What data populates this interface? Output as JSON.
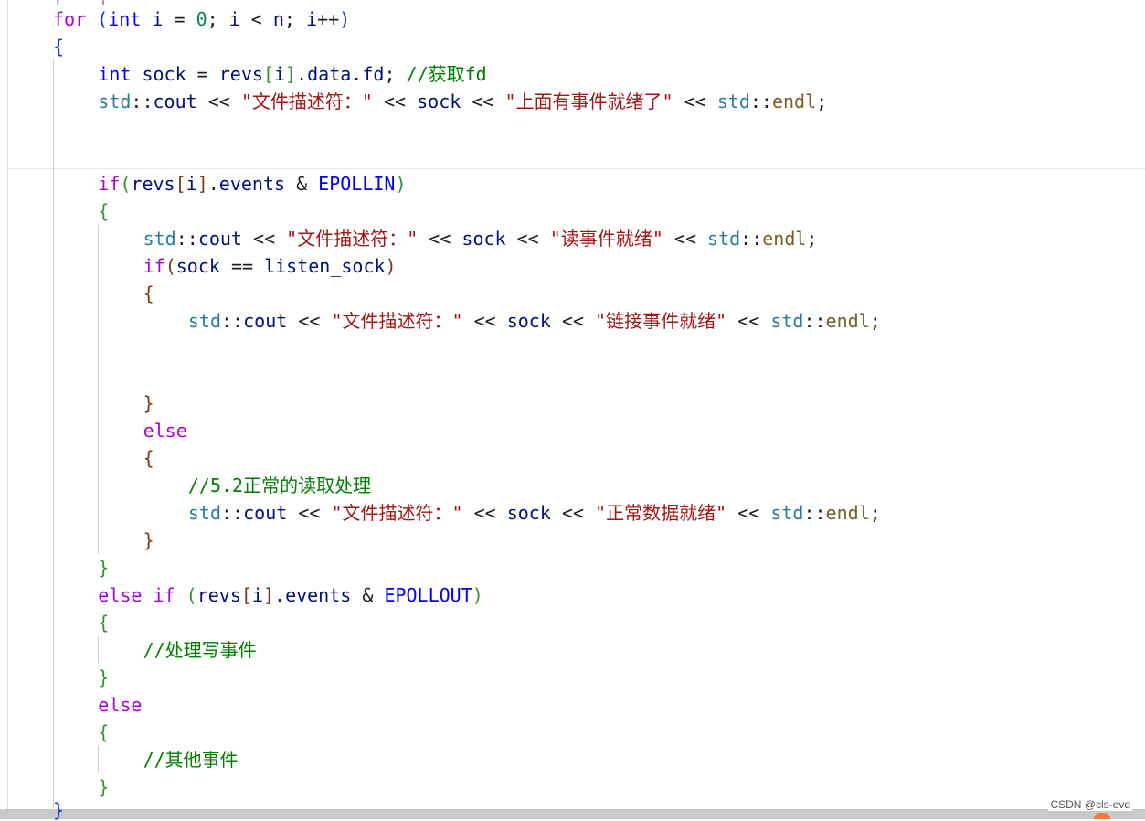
{
  "editor": {
    "top_partial": "( , )",
    "code_lines": [
      {
        "indent": 1,
        "tokens": [
          [
            "kw",
            "for"
          ],
          [
            "p",
            " "
          ],
          [
            "b1",
            "("
          ],
          [
            "ty",
            "int"
          ],
          [
            "p",
            " "
          ],
          [
            "var",
            "i"
          ],
          [
            "p",
            " = "
          ],
          [
            "num",
            "0"
          ],
          [
            "p",
            "; "
          ],
          [
            "var",
            "i"
          ],
          [
            "p",
            " < "
          ],
          [
            "var",
            "n"
          ],
          [
            "p",
            "; "
          ],
          [
            "var",
            "i"
          ],
          [
            "p",
            "++"
          ],
          [
            "b1",
            ")"
          ]
        ]
      },
      {
        "indent": 1,
        "tokens": [
          [
            "b1",
            "{"
          ]
        ]
      },
      {
        "indent": 2,
        "tokens": [
          [
            "ty",
            "int"
          ],
          [
            "p",
            " "
          ],
          [
            "var",
            "sock"
          ],
          [
            "p",
            " = "
          ],
          [
            "var",
            "revs"
          ],
          [
            "b2",
            "["
          ],
          [
            "var",
            "i"
          ],
          [
            "b2",
            "]"
          ],
          [
            "p",
            "."
          ],
          [
            "var",
            "data"
          ],
          [
            "p",
            "."
          ],
          [
            "var",
            "fd"
          ],
          [
            "p",
            "; "
          ],
          [
            "cmt",
            "//获取fd"
          ]
        ]
      },
      {
        "indent": 2,
        "tokens": [
          [
            "ns",
            "std"
          ],
          [
            "p",
            "::"
          ],
          [
            "var",
            "cout"
          ],
          [
            "p",
            " << "
          ],
          [
            "str",
            "\"文件描述符：\""
          ],
          [
            "p",
            " << "
          ],
          [
            "var",
            "sock"
          ],
          [
            "p",
            " << "
          ],
          [
            "str",
            "\"上面有事件就绪了\""
          ],
          [
            "p",
            " << "
          ],
          [
            "ns",
            "std"
          ],
          [
            "p",
            "::"
          ],
          [
            "fn",
            "endl"
          ],
          [
            "p",
            ";"
          ]
        ]
      },
      {
        "indent": 0,
        "tokens": []
      },
      {
        "indent": 0,
        "tokens": []
      },
      {
        "indent": 2,
        "tokens": [
          [
            "kw",
            "if"
          ],
          [
            "b2",
            "("
          ],
          [
            "var",
            "revs"
          ],
          [
            "b3",
            "["
          ],
          [
            "var",
            "i"
          ],
          [
            "b3",
            "]"
          ],
          [
            "p",
            "."
          ],
          [
            "var",
            "events"
          ],
          [
            "p",
            " & "
          ],
          [
            "con",
            "EPOLLIN"
          ],
          [
            "b2",
            ")"
          ]
        ]
      },
      {
        "indent": 2,
        "tokens": [
          [
            "b2",
            "{"
          ]
        ]
      },
      {
        "indent": 3,
        "tokens": [
          [
            "ns",
            "std"
          ],
          [
            "p",
            "::"
          ],
          [
            "var",
            "cout"
          ],
          [
            "p",
            " << "
          ],
          [
            "str",
            "\"文件描述符：\""
          ],
          [
            "p",
            " << "
          ],
          [
            "var",
            "sock"
          ],
          [
            "p",
            " << "
          ],
          [
            "str",
            "\"读事件就绪\""
          ],
          [
            "p",
            " << "
          ],
          [
            "ns",
            "std"
          ],
          [
            "p",
            "::"
          ],
          [
            "fn",
            "endl"
          ],
          [
            "p",
            ";"
          ]
        ]
      },
      {
        "indent": 3,
        "tokens": [
          [
            "kw",
            "if"
          ],
          [
            "b3",
            "("
          ],
          [
            "var",
            "sock"
          ],
          [
            "p",
            " == "
          ],
          [
            "var",
            "listen_sock"
          ],
          [
            "b3",
            ")"
          ]
        ]
      },
      {
        "indent": 3,
        "tokens": [
          [
            "b3",
            "{"
          ]
        ]
      },
      {
        "indent": 4,
        "tokens": [
          [
            "ns",
            "std"
          ],
          [
            "p",
            "::"
          ],
          [
            "var",
            "cout"
          ],
          [
            "p",
            " << "
          ],
          [
            "str",
            "\"文件描述符：\""
          ],
          [
            "p",
            " << "
          ],
          [
            "var",
            "sock"
          ],
          [
            "p",
            " << "
          ],
          [
            "str",
            "\"链接事件就绪\""
          ],
          [
            "p",
            " << "
          ],
          [
            "ns",
            "std"
          ],
          [
            "p",
            "::"
          ],
          [
            "fn",
            "endl"
          ],
          [
            "p",
            ";"
          ]
        ]
      },
      {
        "indent": 0,
        "tokens": []
      },
      {
        "indent": 0,
        "tokens": []
      },
      {
        "indent": 3,
        "tokens": [
          [
            "b3",
            "}"
          ]
        ]
      },
      {
        "indent": 3,
        "tokens": [
          [
            "kw",
            "else"
          ]
        ]
      },
      {
        "indent": 3,
        "tokens": [
          [
            "b3",
            "{"
          ]
        ]
      },
      {
        "indent": 4,
        "tokens": [
          [
            "cmt",
            "//5.2正常的读取处理"
          ]
        ]
      },
      {
        "indent": 4,
        "tokens": [
          [
            "ns",
            "std"
          ],
          [
            "p",
            "::"
          ],
          [
            "var",
            "cout"
          ],
          [
            "p",
            " << "
          ],
          [
            "str",
            "\"文件描述符：\""
          ],
          [
            "p",
            " << "
          ],
          [
            "var",
            "sock"
          ],
          [
            "p",
            " << "
          ],
          [
            "str",
            "\"正常数据就绪\""
          ],
          [
            "p",
            " << "
          ],
          [
            "ns",
            "std"
          ],
          [
            "p",
            "::"
          ],
          [
            "fn",
            "endl"
          ],
          [
            "p",
            ";"
          ]
        ]
      },
      {
        "indent": 3,
        "tokens": [
          [
            "b3",
            "}"
          ]
        ]
      },
      {
        "indent": 2,
        "tokens": [
          [
            "b2",
            "}"
          ]
        ]
      },
      {
        "indent": 2,
        "tokens": [
          [
            "kw",
            "else"
          ],
          [
            "p",
            " "
          ],
          [
            "kw",
            "if"
          ],
          [
            "p",
            " "
          ],
          [
            "b2",
            "("
          ],
          [
            "var",
            "revs"
          ],
          [
            "b3",
            "["
          ],
          [
            "var",
            "i"
          ],
          [
            "b3",
            "]"
          ],
          [
            "p",
            "."
          ],
          [
            "var",
            "events"
          ],
          [
            "p",
            " & "
          ],
          [
            "con",
            "EPOLLOUT"
          ],
          [
            "b2",
            ")"
          ]
        ]
      },
      {
        "indent": 2,
        "tokens": [
          [
            "b2",
            "{"
          ]
        ]
      },
      {
        "indent": 3,
        "tokens": [
          [
            "cmt",
            "//处理写事件"
          ]
        ]
      },
      {
        "indent": 2,
        "tokens": [
          [
            "b2",
            "}"
          ]
        ]
      },
      {
        "indent": 2,
        "tokens": [
          [
            "kw",
            "else"
          ]
        ]
      },
      {
        "indent": 2,
        "tokens": [
          [
            "b2",
            "{"
          ]
        ]
      },
      {
        "indent": 3,
        "tokens": [
          [
            "cmt",
            "//其他事件"
          ]
        ]
      },
      {
        "indent": 2,
        "tokens": [
          [
            "b2",
            "}"
          ]
        ]
      }
    ],
    "closing_brace": "}"
  },
  "watermark": "CSDN @cls-evd",
  "colors": {
    "keyword": "#af00db",
    "type": "#0000ff",
    "namespace": "#267f99",
    "function": "#795e26",
    "variable": "#001080",
    "string": "#a31515",
    "comment": "#008000",
    "number": "#098658",
    "bracket_level1": "#0431fa",
    "bracket_level2": "#319331",
    "bracket_level3": "#7b3814"
  }
}
